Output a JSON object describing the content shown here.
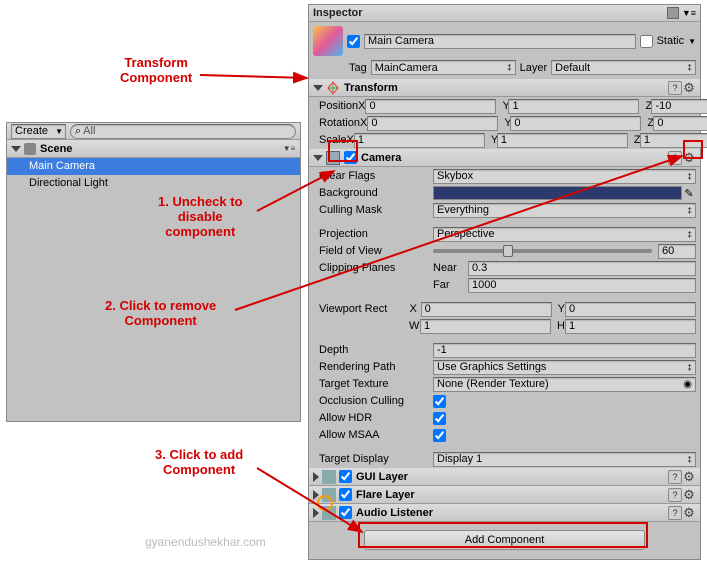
{
  "hierarchy": {
    "create_label": "Create",
    "search_placeholder": "All",
    "scene_label": "Scene",
    "items": [
      "Main Camera",
      "Directional Light"
    ]
  },
  "inspector": {
    "title": "Inspector",
    "name_value": "Main Camera",
    "static_label": "Static",
    "tag_label": "Tag",
    "tag_value": "MainCamera",
    "layer_label": "Layer",
    "layer_value": "Default"
  },
  "transform": {
    "title": "Transform",
    "rows": {
      "position": "Position",
      "rotation": "Rotation",
      "scale": "Scale"
    },
    "pos": {
      "x": "0",
      "y": "1",
      "z": "-10"
    },
    "rot": {
      "x": "0",
      "y": "0",
      "z": "0"
    },
    "scl": {
      "x": "1",
      "y": "1",
      "z": "1"
    }
  },
  "camera": {
    "title": "Camera",
    "clear_flags": "Clear Flags",
    "clear_flags_value": "Skybox",
    "background": "Background",
    "culling_mask": "Culling Mask",
    "culling_mask_value": "Everything",
    "projection": "Projection",
    "projection_value": "Perspective",
    "fov": "Field of View",
    "fov_value": "60",
    "clipping": "Clipping Planes",
    "near": "Near",
    "near_value": "0.3",
    "far": "Far",
    "far_value": "1000",
    "viewport": "Viewport Rect",
    "vp": {
      "x": "0",
      "y": "0",
      "w": "1",
      "h": "1"
    },
    "depth": "Depth",
    "depth_value": "-1",
    "rendering_path": "Rendering Path",
    "rendering_path_value": "Use Graphics Settings",
    "target_texture": "Target Texture",
    "target_texture_value": "None (Render Texture)",
    "occlusion": "Occlusion Culling",
    "hdr": "Allow HDR",
    "msaa": "Allow MSAA",
    "target_display": "Target Display",
    "target_display_value": "Display 1"
  },
  "components": {
    "gui_layer": "GUI Layer",
    "flare_layer": "Flare Layer",
    "audio_listener": "Audio Listener"
  },
  "add_component": "Add Component",
  "annotations": {
    "transform": "Transform\nComponent",
    "a1": "1. Uncheck to\ndisable\ncomponent",
    "a2": "2. Click to remove\nComponent",
    "a3": "3. Click to add\nComponent",
    "watermark": "gyanendushekhar.com"
  }
}
